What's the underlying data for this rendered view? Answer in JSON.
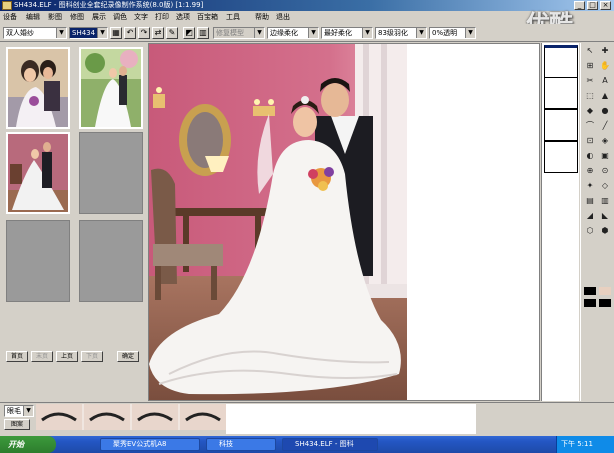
{
  "window": {
    "title": "SH434.ELF - 图科创业全套纪录像制作系统(8.0版) [1:1.99]",
    "minimize": "_",
    "maximize": "□",
    "close": "×"
  },
  "watermark": "优酷",
  "menu": [
    "设备",
    "编辑",
    "影图",
    "修图",
    "展示",
    "调色",
    "文字",
    "打印",
    "选项",
    "百宝箱",
    "工具",
    "帮助",
    "退出"
  ],
  "toolbar": {
    "category_combo": "双人婚纱",
    "file_combo": "SH434",
    "disabled_combo": "修复模型",
    "edge_combo": "边缘柔化",
    "smooth_combo": "最好柔化",
    "feather_combo": "83级羽化",
    "opacity_combo": "0%透明"
  },
  "leftpanel": {
    "nav_buttons": [
      "首页",
      "末页",
      "上页",
      "下页",
      "确定"
    ]
  },
  "tool_glyphs": [
    "↖",
    "✚",
    "⊞",
    "✋",
    "✂",
    "A",
    "⬚",
    "▲",
    "◆",
    "●",
    "⌒",
    "╱",
    "⊡",
    "◈",
    "◐",
    "▣",
    "⊕",
    "⊙",
    "✦",
    "◇",
    "▤",
    "▥",
    "◢",
    "◣",
    "⬡",
    "⬢"
  ],
  "bottom": {
    "combo": "眼毛",
    "label": "图案"
  },
  "taskbar": {
    "start": "开始",
    "tasks": [
      "聚秀EV公式机A8",
      "科技",
      "SH434.ELF - 图科"
    ],
    "clock": "下午 5:11"
  }
}
